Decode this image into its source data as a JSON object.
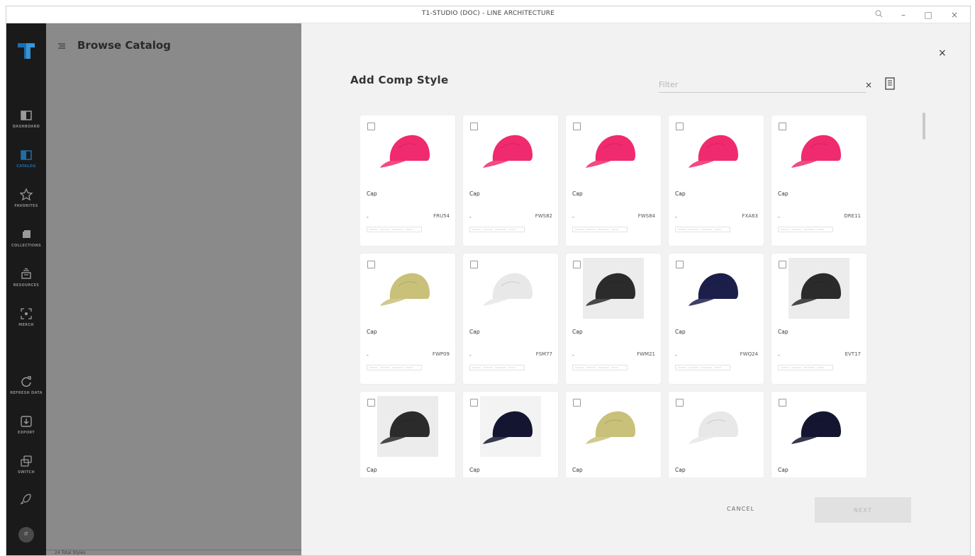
{
  "window": {
    "title": "T1-STUDIO (DOC) - LINE ARCHITECTURE",
    "controls": [
      "search-icon",
      "minimize-icon",
      "maximize-icon",
      "close-icon"
    ]
  },
  "sidebar": {
    "items": [
      {
        "label": "DASHBOARD",
        "icon": "dashboard-icon"
      },
      {
        "label": "CATALOG",
        "icon": "catalog-icon",
        "active": true
      },
      {
        "label": "FAVORITES",
        "icon": "star-icon"
      },
      {
        "label": "COLLECTIONS",
        "icon": "collections-icon"
      },
      {
        "label": "RESOURCES",
        "icon": "resources-icon"
      },
      {
        "label": "MERCH",
        "icon": "merch-icon"
      },
      {
        "label": "REFRESH DATA",
        "icon": "refresh-icon"
      },
      {
        "label": "EXPORT",
        "icon": "export-icon"
      },
      {
        "label": "SWITCH",
        "icon": "switch-icon"
      },
      {
        "label": "",
        "icon": "rocket-icon"
      }
    ],
    "avatar": "IT",
    "accent": "#1f6fa6"
  },
  "browse": {
    "title": "Browse Catalog",
    "footer": "24 Total Styles"
  },
  "dialog": {
    "title": "Add Comp Style",
    "filter_placeholder": "Filter",
    "cancel_label": "CANCEL",
    "next_label": "NEXT"
  },
  "styles": [
    {
      "name": "Cap",
      "dash": "-",
      "code": "FRU54",
      "color": "#f02a6e",
      "bg": "none"
    },
    {
      "name": "Cap",
      "dash": "-",
      "code": "FWS82",
      "color": "#f02a6e",
      "bg": "none"
    },
    {
      "name": "Cap",
      "dash": "-",
      "code": "FWS84",
      "color": "#f02a6e",
      "bg": "none"
    },
    {
      "name": "Cap",
      "dash": "-",
      "code": "FXA63",
      "color": "#f02a6e",
      "bg": "none"
    },
    {
      "name": "Cap",
      "dash": "-",
      "code": "DRE11",
      "color": "#f02a6e",
      "bg": "none"
    },
    {
      "name": "Cap",
      "dash": "-",
      "code": "FWP09",
      "color": "#c9c07a",
      "bg": "none"
    },
    {
      "name": "Cap",
      "dash": "-",
      "code": "FSM77",
      "color": "#e8e8e8",
      "bg": "none"
    },
    {
      "name": "Cap",
      "dash": "-",
      "code": "FWM21",
      "color": "#2b2b2b",
      "bg": "#ececec"
    },
    {
      "name": "Cap",
      "dash": "-",
      "code": "FWQ24",
      "color": "#1c1f4a",
      "bg": "none"
    },
    {
      "name": "Cap",
      "dash": "-",
      "code": "EVT17",
      "color": "#2b2b2b",
      "bg": "#ececec"
    },
    {
      "name": "Cap",
      "dash": "",
      "code": "",
      "color": "#2b2b2b",
      "bg": "#ececec"
    },
    {
      "name": "Cap",
      "dash": "",
      "code": "",
      "color": "#141631",
      "bg": "#f3f3f3"
    },
    {
      "name": "Cap",
      "dash": "",
      "code": "",
      "color": "#c9c07a",
      "bg": "none"
    },
    {
      "name": "Cap",
      "dash": "",
      "code": "",
      "color": "#e8e8e8",
      "bg": "none"
    },
    {
      "name": "Cap",
      "dash": "",
      "code": "",
      "color": "#141631",
      "bg": "none"
    }
  ]
}
